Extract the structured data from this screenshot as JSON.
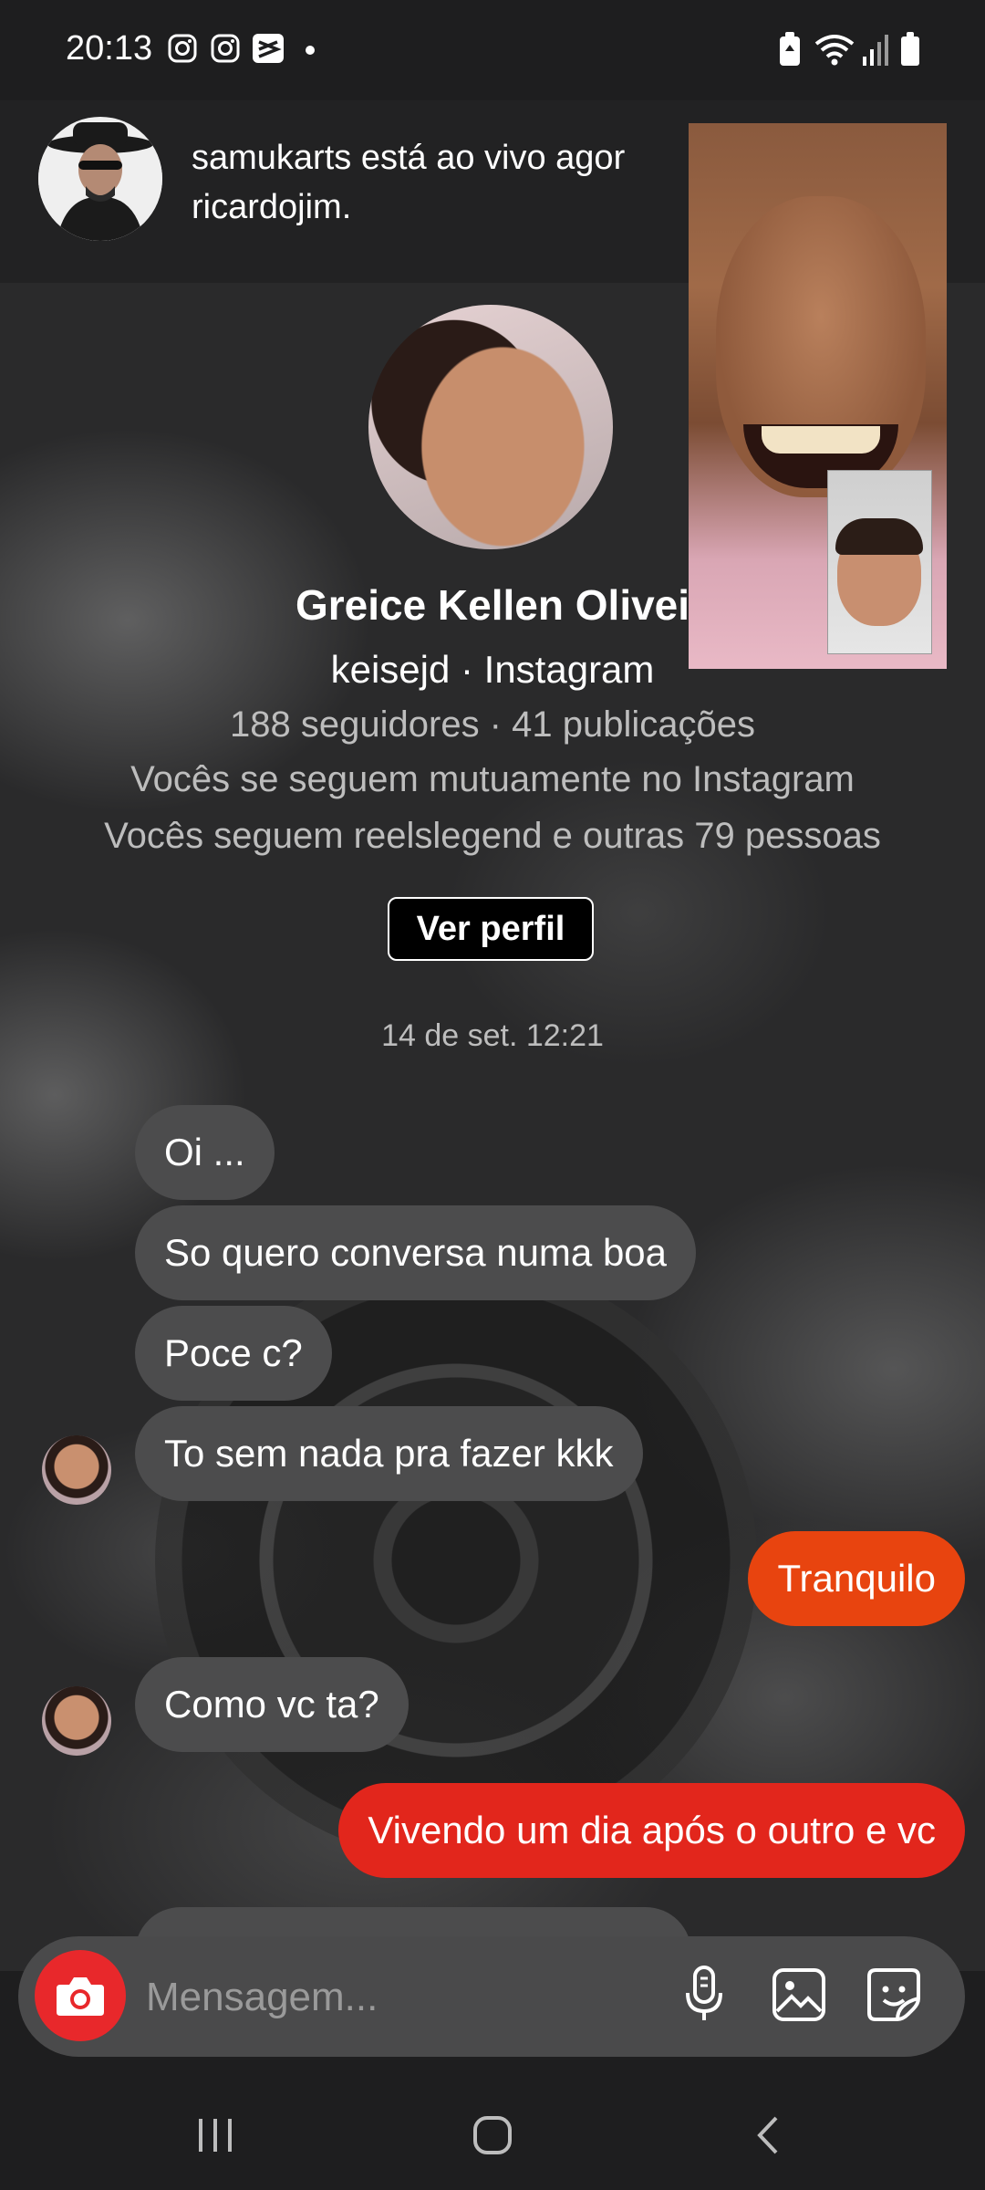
{
  "status_bar": {
    "time": "20:13",
    "icons": [
      "instagram-icon",
      "instagram-icon",
      "capcut-icon",
      "dot-icon",
      "battery-saver-icon",
      "wifi-icon",
      "signal-icon",
      "battery-icon"
    ]
  },
  "notification": {
    "line1": "samukarts está ao vivo agor",
    "line2": "ricardojim."
  },
  "profile": {
    "name": "Greice Kellen Olivei",
    "handle": "keisejd · Instagram",
    "stats": "188 seguidores · 41 publicações",
    "mutual_follow": "Vocês se seguem mutuamente no Instagram",
    "mutual_friends": "Vocês seguem reelslegend e outras 79 pessoas",
    "view_profile_label": "Ver perfil"
  },
  "timestamp": "14 de set. 12:21",
  "messages": [
    {
      "from": "them",
      "text": "Oi ..."
    },
    {
      "from": "them",
      "text": "So quero conversa numa boa"
    },
    {
      "from": "them",
      "text": "Poce c?"
    },
    {
      "from": "them",
      "text": "To sem nada pra fazer kkk"
    },
    {
      "from": "me",
      "text": "Tranquilo"
    },
    {
      "from": "them",
      "text": "Como vc ta?"
    },
    {
      "from": "me",
      "text": "Vivendo um dia após o outro e vc"
    }
  ],
  "composer": {
    "placeholder": "Mensagem...",
    "icons": [
      "camera-icon",
      "microphone-icon",
      "gallery-icon",
      "sticker-icon"
    ]
  },
  "colors": {
    "background": "#1e1e1f",
    "incoming_bubble": "#4c4c4d",
    "outgoing_bubble_orange": "#e8440f",
    "outgoing_bubble_red": "#e2261c",
    "camera_button": "#e8282b"
  },
  "nav": {
    "icons": [
      "recent-apps-icon",
      "home-icon",
      "back-icon"
    ]
  }
}
